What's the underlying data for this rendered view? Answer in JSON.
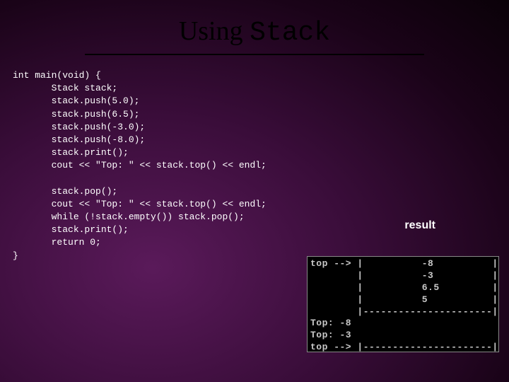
{
  "title": {
    "word1": "Using ",
    "word2": "Stack"
  },
  "code": {
    "line1": "int main(void) {",
    "line2": "       Stack stack;",
    "line3": "       stack.push(5.0);",
    "line4": "       stack.push(6.5);",
    "line5": "       stack.push(-3.0);",
    "line6": "       stack.push(-8.0);",
    "line7": "       stack.print();",
    "line8": "       cout << \"Top: \" << stack.top() << endl;",
    "line9": "",
    "line10": "       stack.pop();",
    "line11": "       cout << \"Top: \" << stack.top() << endl;",
    "line12": "       while (!stack.empty()) stack.pop();",
    "line13": "       stack.print();",
    "line14": "       return 0;",
    "line15": "}"
  },
  "result_label": "result",
  "console": {
    "line1": "top --> |          -8          |",
    "line2": "        |          -3          |",
    "line3": "        |          6.5         |",
    "line4": "        |          5           |",
    "line5": "        |----------------------|",
    "line6": "Top: -8",
    "line7": "Top: -3",
    "line8": "top --> |----------------------|"
  }
}
